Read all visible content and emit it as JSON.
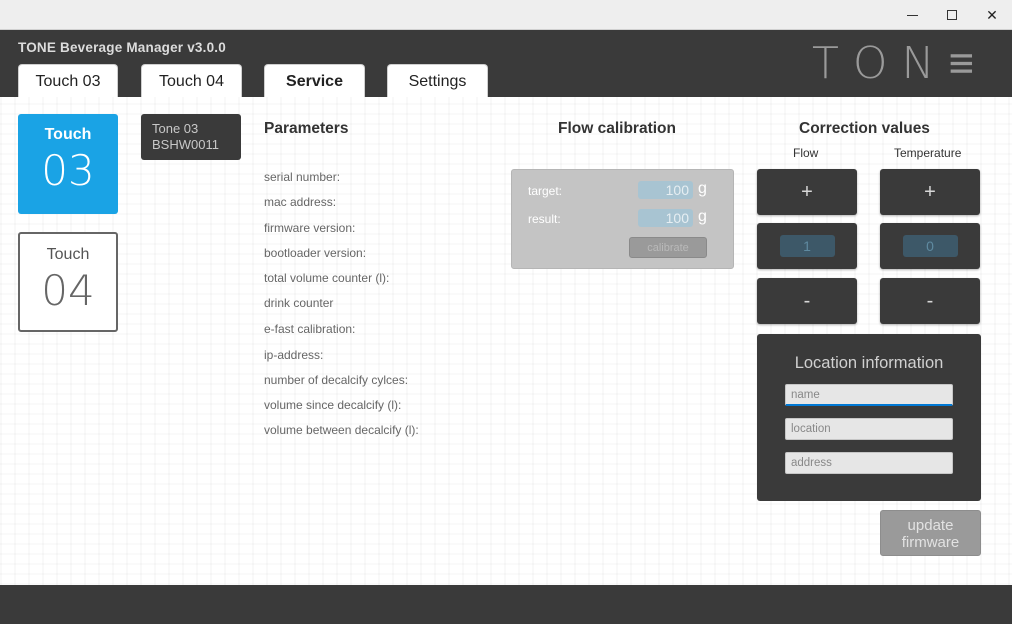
{
  "window": {
    "minimize_glyph": "",
    "close_glyph": "✕"
  },
  "app": {
    "title": "TONE Beverage Manager v3.0.0",
    "logo_letters": [
      "T",
      "O",
      "N",
      "≡"
    ]
  },
  "tabs": [
    {
      "label": "Touch 03",
      "active": false
    },
    {
      "label": "Touch 04",
      "active": false
    },
    {
      "label": "Service",
      "active": true
    },
    {
      "label": "Settings",
      "active": false
    }
  ],
  "devices": [
    {
      "label": "Touch",
      "number": "03",
      "selected": true
    },
    {
      "label": "Touch",
      "number": "04",
      "selected": false
    }
  ],
  "device_badge": {
    "line1": "Tone 03",
    "line2": "BSHW0011"
  },
  "parameters": {
    "title": "Parameters",
    "items": [
      "serial number:",
      "mac address:",
      "firmware version:",
      "bootloader version:",
      "total volume counter (l):",
      "drink counter",
      "e-fast calibration:",
      "ip-address:",
      "number of decalcify cylces:",
      "volume since decalcify (l):",
      "volume between decalcify (l):"
    ]
  },
  "flow_calibration": {
    "title": "Flow calibration",
    "target_label": "target:",
    "target_value": "100",
    "result_label": "result:",
    "result_value": "100",
    "unit": "g",
    "calibrate_label": "calibrate"
  },
  "correction": {
    "title": "Correction values",
    "flow_label": "Flow",
    "temperature_label": "Temperature",
    "plus": "+",
    "minus": "-",
    "flow_value": "1",
    "temperature_value": "0"
  },
  "location": {
    "title": "Location information",
    "name_placeholder": "name",
    "location_placeholder": "location",
    "address_placeholder": "address"
  },
  "update_firmware_label": "update firmware"
}
